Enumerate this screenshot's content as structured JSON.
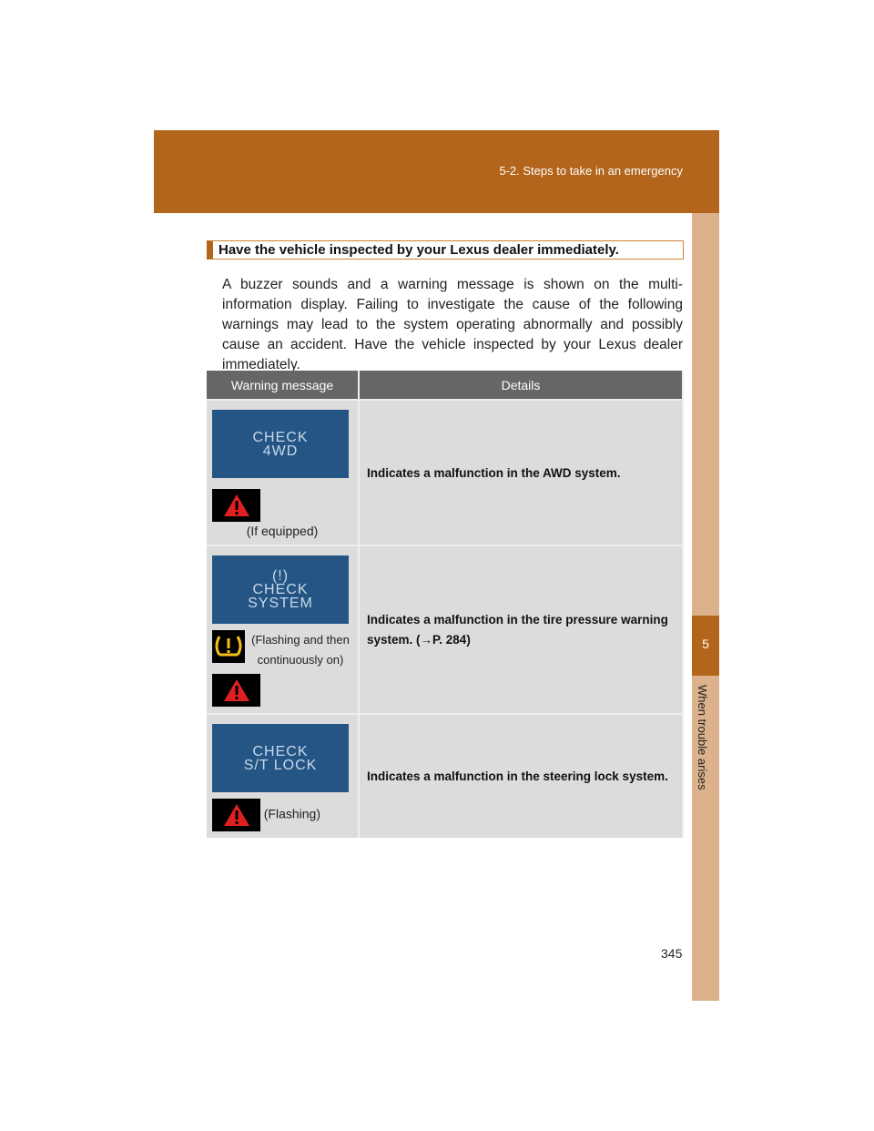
{
  "header": {
    "section": "5-2. Steps to take in an emergency"
  },
  "sidebar": {
    "chapter_number": "5",
    "chapter_title": "When trouble arises"
  },
  "heading": "Have the vehicle inspected by your Lexus dealer immediately.",
  "intro": "A buzzer sounds and a warning message is shown on the multi-information display. Failing to investigate the cause of the following warnings may lead to the system operating abnormally and possibly cause an accident. Have the vehicle inspected by your Lexus dealer immediately.",
  "table": {
    "headers": [
      "Warning message",
      "Details"
    ],
    "rows": [
      {
        "display": [
          "CHECK",
          "4WD"
        ],
        "note": "(If equipped)",
        "details": "Indicates a malfunction in the AWD system.",
        "icons": [
          "master-warning"
        ]
      },
      {
        "display": [
          "(!)",
          "CHECK",
          "SYSTEM"
        ],
        "note": "(Flashing and then continuously on)",
        "details": "Indicates a malfunction in the tire pressure warning system. (→P. 284)",
        "icons": [
          "tire-pressure-warning",
          "master-warning"
        ]
      },
      {
        "display": [
          "CHECK",
          "S/T LOCK"
        ],
        "note": "(Flashing)",
        "details": "Indicates a malfunction in the steering lock system.",
        "icons": [
          "master-warning"
        ]
      }
    ]
  },
  "page_number": "345",
  "colors": {
    "brand": "#b2651b",
    "strip": "#dcb28c",
    "display": "#245584"
  }
}
